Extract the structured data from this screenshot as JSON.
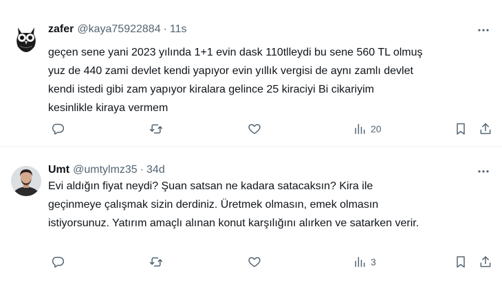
{
  "tweets": [
    {
      "name": "zafer",
      "handle": "@kaya75922884",
      "dot": "·",
      "time": "11s",
      "lines": [
        "geçen sene yani 2023 yılında 1+1 evin dask 110tlleydi bu sene 560 TL olmuş",
        "yuz de 440 zami devlet kendi yapıyor evin yıllık vergisi de aynı zamlı devlet",
        "kendi istedi gibi zam yapıyor kiralara gelince 25 kiraciyi Bi cikariyim",
        "kesinlikle kiraya vermem"
      ],
      "views_count": "20",
      "avatar_icon": "owl-avatar",
      "more_icon": "more-icon"
    },
    {
      "name": "Umt",
      "handle": "@umtylmz35",
      "dot": "·",
      "time": "34d",
      "lines": [
        "Evi aldığın fiyat neydi? Şuan satsan ne kadara satacaksın? Kira ile",
        "geçinmeye çalışmak sizin derdiniz. Üretmek olmasın, emek olmasın",
        "istiyorsunuz. Yatırım amaçlı alınan konut karşılığını alırken ve satarken verir."
      ],
      "views_count": "3",
      "avatar_icon": "man-avatar",
      "more_icon": "more-icon"
    }
  ],
  "colors": {
    "text": "#0f1419",
    "secondary": "#536471",
    "divider": "#eff3f4"
  }
}
